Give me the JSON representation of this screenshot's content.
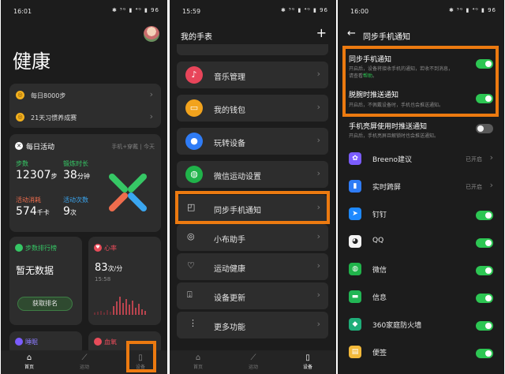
{
  "screen1": {
    "time": "16:01",
    "status_icons": "✱ ⁵ᴳ ▮ ⁴ᴳ ▮ 96",
    "title": "健康",
    "task1": "每日8000步",
    "task2": "21天习惯养成赛",
    "daily_title": "每日活动",
    "daily_source": "手机+穿戴 | 今天",
    "steps_label": "步数",
    "steps_value": "12307",
    "steps_unit": "步",
    "exercise_label": "锻炼时长",
    "exercise_value": "38",
    "exercise_unit": "分钟",
    "calorie_label": "活动消耗",
    "calorie_value": "574",
    "calorie_unit": "千卡",
    "active_label": "活动次数",
    "active_value": "9",
    "active_unit": "次",
    "rank_title": "步数排行榜",
    "rank_empty": "暂无数据",
    "rank_button": "获取排名",
    "hr_title": "心率",
    "hr_value": "83",
    "hr_unit": "次/分",
    "hr_time": "15:58",
    "sleep_title": "睡眠",
    "bp_title": "血氧",
    "nav": [
      "首页",
      "运动",
      "设备"
    ]
  },
  "screen2": {
    "time": "15:59",
    "status_icons": "✱ ⁵ᴳ ▮ ⁴ᴳ ▮ 96",
    "title": "我的手表",
    "add": "+",
    "menu": [
      "音乐管理",
      "我的钱包",
      "玩转设备",
      "微信运动设置",
      "同步手机通知",
      "小布助手",
      "运动健康",
      "设备更新",
      "更多功能"
    ],
    "nav": [
      "首页",
      "运动",
      "设备"
    ]
  },
  "screen3": {
    "time": "16:00",
    "status_icons": "✱ ⁵ᴳ ▮ ⁴ᴳ ▮ 96",
    "title": "同步手机通知",
    "sync_title": "同步手机通知",
    "sync_desc_1": "开启后，设备将接收手机的通知，若收不到消息，",
    "sync_desc_2a": "请查看",
    "sync_desc_2b": "帮助",
    "sync_desc_2c": "。",
    "wrist_title": "脱腕时推送通知",
    "wrist_desc": "开启后，不佩戴设备时，手机也会推送通知。",
    "bright_title": "手机亮屏使用时推送通知",
    "bright_desc": "开启后，手机亮屏且解锁时也会推送通知。",
    "apps": [
      {
        "name": "Breeno建议",
        "status": "已开启",
        "icon": "✿",
        "color": "#7b5cff"
      },
      {
        "name": "实时跨屏",
        "status": "已开启",
        "icon": "▮",
        "color": "#2f7cf6"
      },
      {
        "name": "钉钉",
        "status": "",
        "icon": "➤",
        "color": "#1e89ff"
      },
      {
        "name": "QQ",
        "status": "",
        "icon": "◕",
        "color": "#f4f4f4"
      },
      {
        "name": "微信",
        "status": "",
        "icon": "◍",
        "color": "#20b34a"
      },
      {
        "name": "信息",
        "status": "",
        "icon": "▬",
        "color": "#22b655"
      },
      {
        "name": "360家庭防火墙",
        "status": "",
        "icon": "◆",
        "color": "#1fae79"
      },
      {
        "name": "便签",
        "status": "",
        "icon": "▤",
        "color": "#f3b93a"
      }
    ]
  }
}
